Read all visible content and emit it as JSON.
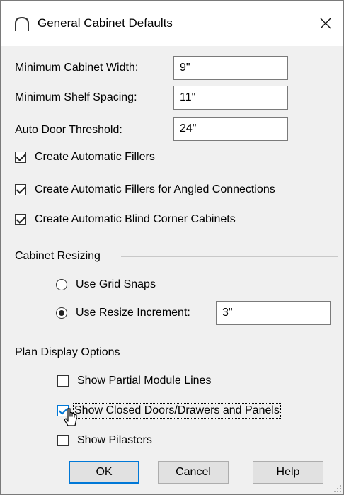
{
  "window": {
    "title": "General Cabinet Defaults",
    "close_glyph": "✕",
    "app_icon": "arch-icon"
  },
  "fields": {
    "min_cabinet_width": {
      "label": "Minimum Cabinet Width:",
      "value": "9\""
    },
    "min_shelf_spacing": {
      "label": "Minimum Shelf Spacing:",
      "value": "11\""
    },
    "auto_door_threshold": {
      "label": "Auto Door Threshold:",
      "value": "24\""
    }
  },
  "checkboxes": {
    "auto_fillers": {
      "label": "Create Automatic Fillers",
      "checked": true
    },
    "auto_fillers_angled": {
      "label": "Create Automatic Fillers for Angled Connections",
      "checked": true
    },
    "auto_blind_corner": {
      "label": "Create Automatic Blind Corner Cabinets",
      "checked": true
    }
  },
  "cabinet_resizing": {
    "title": "Cabinet Resizing",
    "grid_snaps_label": "Use Grid Snaps",
    "resize_increment_label": "Use Resize Increment:",
    "resize_increment_value": "3\"",
    "selected": "resize_increment"
  },
  "plan_display": {
    "title": "Plan Display Options",
    "partial_module_lines": {
      "label": "Show Partial Module Lines",
      "checked": false
    },
    "closed_doors": {
      "label": "Show Closed Doors/Drawers and Panels",
      "checked": true
    },
    "pilasters": {
      "label": "Show Pilasters",
      "checked": false
    }
  },
  "buttons": {
    "ok": "OK",
    "cancel": "Cancel",
    "help": "Help"
  },
  "colors": {
    "accent": "#0078d7",
    "dialog_bg": "#f0f0f0"
  }
}
